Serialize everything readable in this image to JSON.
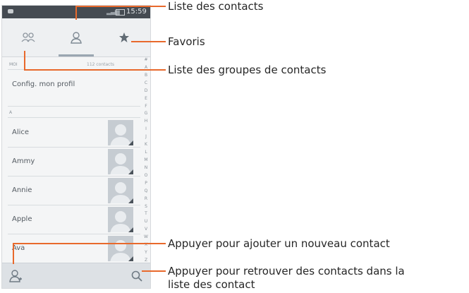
{
  "status_bar": {
    "time": "15:59"
  },
  "tabs": [
    {
      "id": "groups",
      "icon": "group-icon"
    },
    {
      "id": "contacts",
      "icon": "person-icon"
    },
    {
      "id": "favorites",
      "icon": "star-icon"
    }
  ],
  "list": {
    "me_header": "MOI",
    "me_count": "112 contacts",
    "profile_label": "Config. mon profil",
    "section_a": "A",
    "contacts": [
      {
        "name": "Alice"
      },
      {
        "name": "Ammy"
      },
      {
        "name": "Annie"
      },
      {
        "name": "Apple"
      },
      {
        "name": "Ava"
      }
    ]
  },
  "alphabet": [
    "#",
    "A",
    "B",
    "C",
    "D",
    "E",
    "F",
    "G",
    "H",
    "I",
    "J",
    "K",
    "L",
    "M",
    "N",
    "O",
    "P",
    "Q",
    "R",
    "S",
    "T",
    "U",
    "V",
    "W",
    "X",
    "Y",
    "Z"
  ],
  "bottom_bar": {
    "add_icon": "add-person-icon",
    "search_icon": "search-icon"
  },
  "annotations": {
    "contacts_list": "Liste des contacts",
    "favorites": "Favoris",
    "groups_list": "Liste des groupes de contacts",
    "add_contact": "Appuyer pour ajouter un nouveau contact",
    "search_line1": "Appuyer pour retrouver des contacts dans la",
    "search_line2": "liste des contact"
  },
  "colors": {
    "callout": "#e8692c",
    "status_bar": "#454b52"
  }
}
